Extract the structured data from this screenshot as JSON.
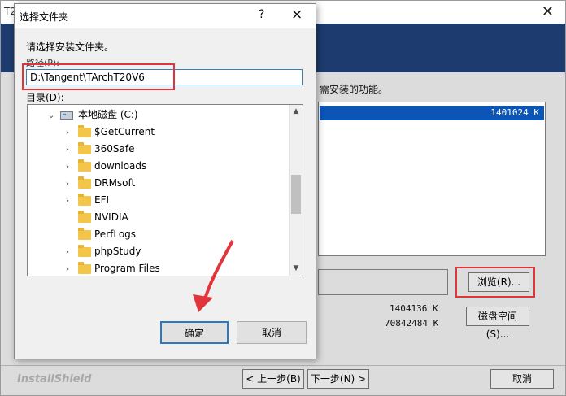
{
  "installer": {
    "title": "T2",
    "close_icon": "close-icon",
    "description": "需安装的功能。",
    "selected_size": "1401024 K",
    "browse_label": "浏览(R)...",
    "space_label": "磁盘空间(S)...",
    "required_size": "1404136 K",
    "available_size": "70842484 K",
    "brand": "InstallShield",
    "back_label": "< 上一步(B)",
    "next_label": "下一步(N) >",
    "cancel_label": "取消"
  },
  "dialog": {
    "title": "选择文件夹",
    "help_label": "?",
    "close_label": "×",
    "prompt": "请选择安装文件夹。",
    "path_label": "路径(P):",
    "path_value": "D:\\Tangent\\TArchT20V6",
    "dir_label": "目录(D):",
    "ok_label": "确定",
    "cancel_label": "取消",
    "tree": {
      "drive": "本地磁盘 (C:)",
      "folders": [
        {
          "name": "$GetCurrent",
          "expandable": true
        },
        {
          "name": "360Safe",
          "expandable": true
        },
        {
          "name": "downloads",
          "expandable": true
        },
        {
          "name": "DRMsoft",
          "expandable": true
        },
        {
          "name": "EFI",
          "expandable": true
        },
        {
          "name": "NVIDIA",
          "expandable": false
        },
        {
          "name": "PerfLogs",
          "expandable": false
        },
        {
          "name": "phpStudy",
          "expandable": true
        },
        {
          "name": "Program Files",
          "expandable": true
        }
      ]
    }
  },
  "colors": {
    "highlight_red": "#e0353a",
    "selection_blue": "#0a55b5",
    "banner_navy": "#1d3b6e"
  }
}
